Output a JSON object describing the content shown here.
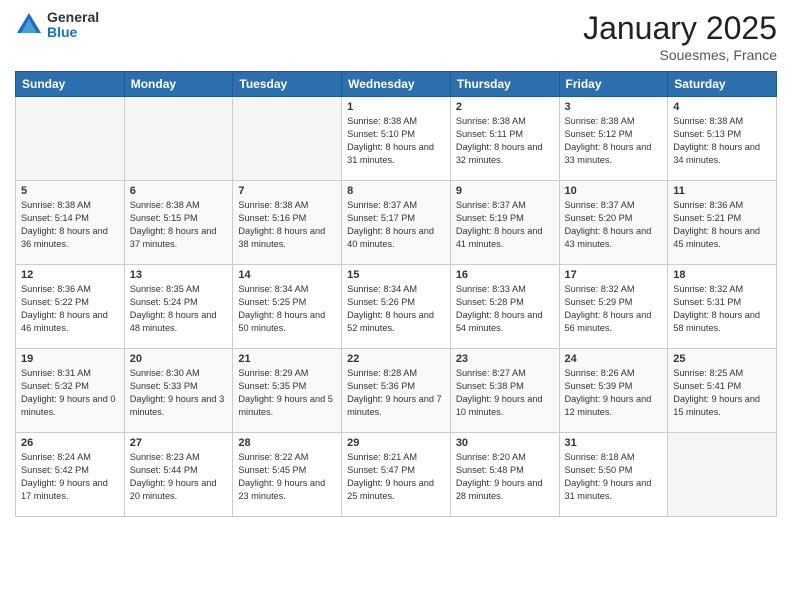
{
  "header": {
    "logo_general": "General",
    "logo_blue": "Blue",
    "month_title": "January 2025",
    "location": "Souesmes, France"
  },
  "days_of_week": [
    "Sunday",
    "Monday",
    "Tuesday",
    "Wednesday",
    "Thursday",
    "Friday",
    "Saturday"
  ],
  "weeks": [
    [
      {
        "day": "",
        "empty": true
      },
      {
        "day": "",
        "empty": true
      },
      {
        "day": "",
        "empty": true
      },
      {
        "day": "1",
        "sunrise": "8:38 AM",
        "sunset": "5:10 PM",
        "daylight": "8 hours and 31 minutes."
      },
      {
        "day": "2",
        "sunrise": "8:38 AM",
        "sunset": "5:11 PM",
        "daylight": "8 hours and 32 minutes."
      },
      {
        "day": "3",
        "sunrise": "8:38 AM",
        "sunset": "5:12 PM",
        "daylight": "8 hours and 33 minutes."
      },
      {
        "day": "4",
        "sunrise": "8:38 AM",
        "sunset": "5:13 PM",
        "daylight": "8 hours and 34 minutes."
      }
    ],
    [
      {
        "day": "5",
        "sunrise": "8:38 AM",
        "sunset": "5:14 PM",
        "daylight": "8 hours and 36 minutes."
      },
      {
        "day": "6",
        "sunrise": "8:38 AM",
        "sunset": "5:15 PM",
        "daylight": "8 hours and 37 minutes."
      },
      {
        "day": "7",
        "sunrise": "8:38 AM",
        "sunset": "5:16 PM",
        "daylight": "8 hours and 38 minutes."
      },
      {
        "day": "8",
        "sunrise": "8:37 AM",
        "sunset": "5:17 PM",
        "daylight": "8 hours and 40 minutes."
      },
      {
        "day": "9",
        "sunrise": "8:37 AM",
        "sunset": "5:19 PM",
        "daylight": "8 hours and 41 minutes."
      },
      {
        "day": "10",
        "sunrise": "8:37 AM",
        "sunset": "5:20 PM",
        "daylight": "8 hours and 43 minutes."
      },
      {
        "day": "11",
        "sunrise": "8:36 AM",
        "sunset": "5:21 PM",
        "daylight": "8 hours and 45 minutes."
      }
    ],
    [
      {
        "day": "12",
        "sunrise": "8:36 AM",
        "sunset": "5:22 PM",
        "daylight": "8 hours and 46 minutes."
      },
      {
        "day": "13",
        "sunrise": "8:35 AM",
        "sunset": "5:24 PM",
        "daylight": "8 hours and 48 minutes."
      },
      {
        "day": "14",
        "sunrise": "8:34 AM",
        "sunset": "5:25 PM",
        "daylight": "8 hours and 50 minutes."
      },
      {
        "day": "15",
        "sunrise": "8:34 AM",
        "sunset": "5:26 PM",
        "daylight": "8 hours and 52 minutes."
      },
      {
        "day": "16",
        "sunrise": "8:33 AM",
        "sunset": "5:28 PM",
        "daylight": "8 hours and 54 minutes."
      },
      {
        "day": "17",
        "sunrise": "8:32 AM",
        "sunset": "5:29 PM",
        "daylight": "8 hours and 56 minutes."
      },
      {
        "day": "18",
        "sunrise": "8:32 AM",
        "sunset": "5:31 PM",
        "daylight": "8 hours and 58 minutes."
      }
    ],
    [
      {
        "day": "19",
        "sunrise": "8:31 AM",
        "sunset": "5:32 PM",
        "daylight": "9 hours and 0 minutes."
      },
      {
        "day": "20",
        "sunrise": "8:30 AM",
        "sunset": "5:33 PM",
        "daylight": "9 hours and 3 minutes."
      },
      {
        "day": "21",
        "sunrise": "8:29 AM",
        "sunset": "5:35 PM",
        "daylight": "9 hours and 5 minutes."
      },
      {
        "day": "22",
        "sunrise": "8:28 AM",
        "sunset": "5:36 PM",
        "daylight": "9 hours and 7 minutes."
      },
      {
        "day": "23",
        "sunrise": "8:27 AM",
        "sunset": "5:38 PM",
        "daylight": "9 hours and 10 minutes."
      },
      {
        "day": "24",
        "sunrise": "8:26 AM",
        "sunset": "5:39 PM",
        "daylight": "9 hours and 12 minutes."
      },
      {
        "day": "25",
        "sunrise": "8:25 AM",
        "sunset": "5:41 PM",
        "daylight": "9 hours and 15 minutes."
      }
    ],
    [
      {
        "day": "26",
        "sunrise": "8:24 AM",
        "sunset": "5:42 PM",
        "daylight": "9 hours and 17 minutes."
      },
      {
        "day": "27",
        "sunrise": "8:23 AM",
        "sunset": "5:44 PM",
        "daylight": "9 hours and 20 minutes."
      },
      {
        "day": "28",
        "sunrise": "8:22 AM",
        "sunset": "5:45 PM",
        "daylight": "9 hours and 23 minutes."
      },
      {
        "day": "29",
        "sunrise": "8:21 AM",
        "sunset": "5:47 PM",
        "daylight": "9 hours and 25 minutes."
      },
      {
        "day": "30",
        "sunrise": "8:20 AM",
        "sunset": "5:48 PM",
        "daylight": "9 hours and 28 minutes."
      },
      {
        "day": "31",
        "sunrise": "8:18 AM",
        "sunset": "5:50 PM",
        "daylight": "9 hours and 31 minutes."
      },
      {
        "day": "",
        "empty": true
      }
    ]
  ]
}
